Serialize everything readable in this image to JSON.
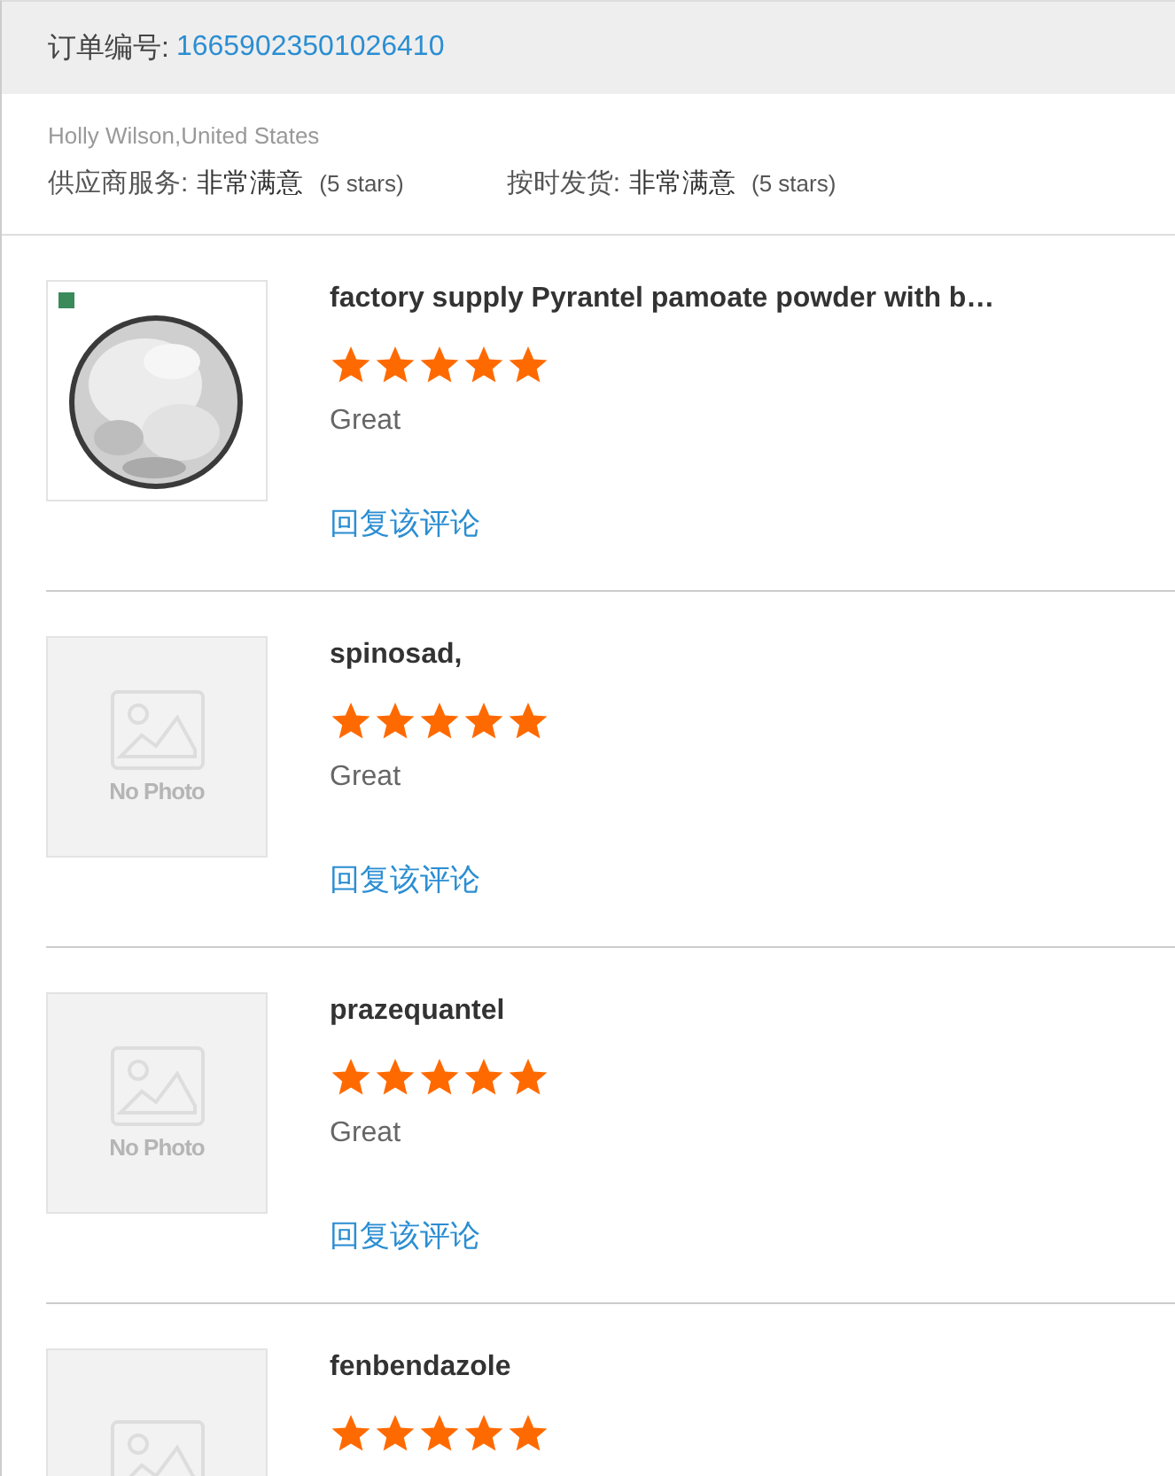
{
  "order": {
    "label": "订单编号:",
    "number": "16659023501026410"
  },
  "buyer": "Holly Wilson,United States",
  "ratings": [
    {
      "label": "供应商服务:",
      "value": "非常满意",
      "note": "(5 stars)"
    },
    {
      "label": "按时发货:",
      "value": "非常满意",
      "note": "(5 stars)"
    }
  ],
  "items": [
    {
      "title": "factory supply Pyrantel pamoate powder with b…",
      "stars": 5,
      "review": "Great",
      "reply": "回复该评论"
    },
    {
      "kind": "placeholder",
      "placeholder_text": "No Photo",
      "title": "spinosad,",
      "stars": 5,
      "review": "Great",
      "reply": "回复该评论"
    },
    {
      "kind": "placeholder",
      "placeholder_text": "No Photo",
      "title": "prazequantel",
      "stars": 5,
      "review": "Great",
      "reply": "回复该评论"
    },
    {
      "kind": "placeholder",
      "title": "fenbendazole",
      "stars": 5
    }
  ]
}
